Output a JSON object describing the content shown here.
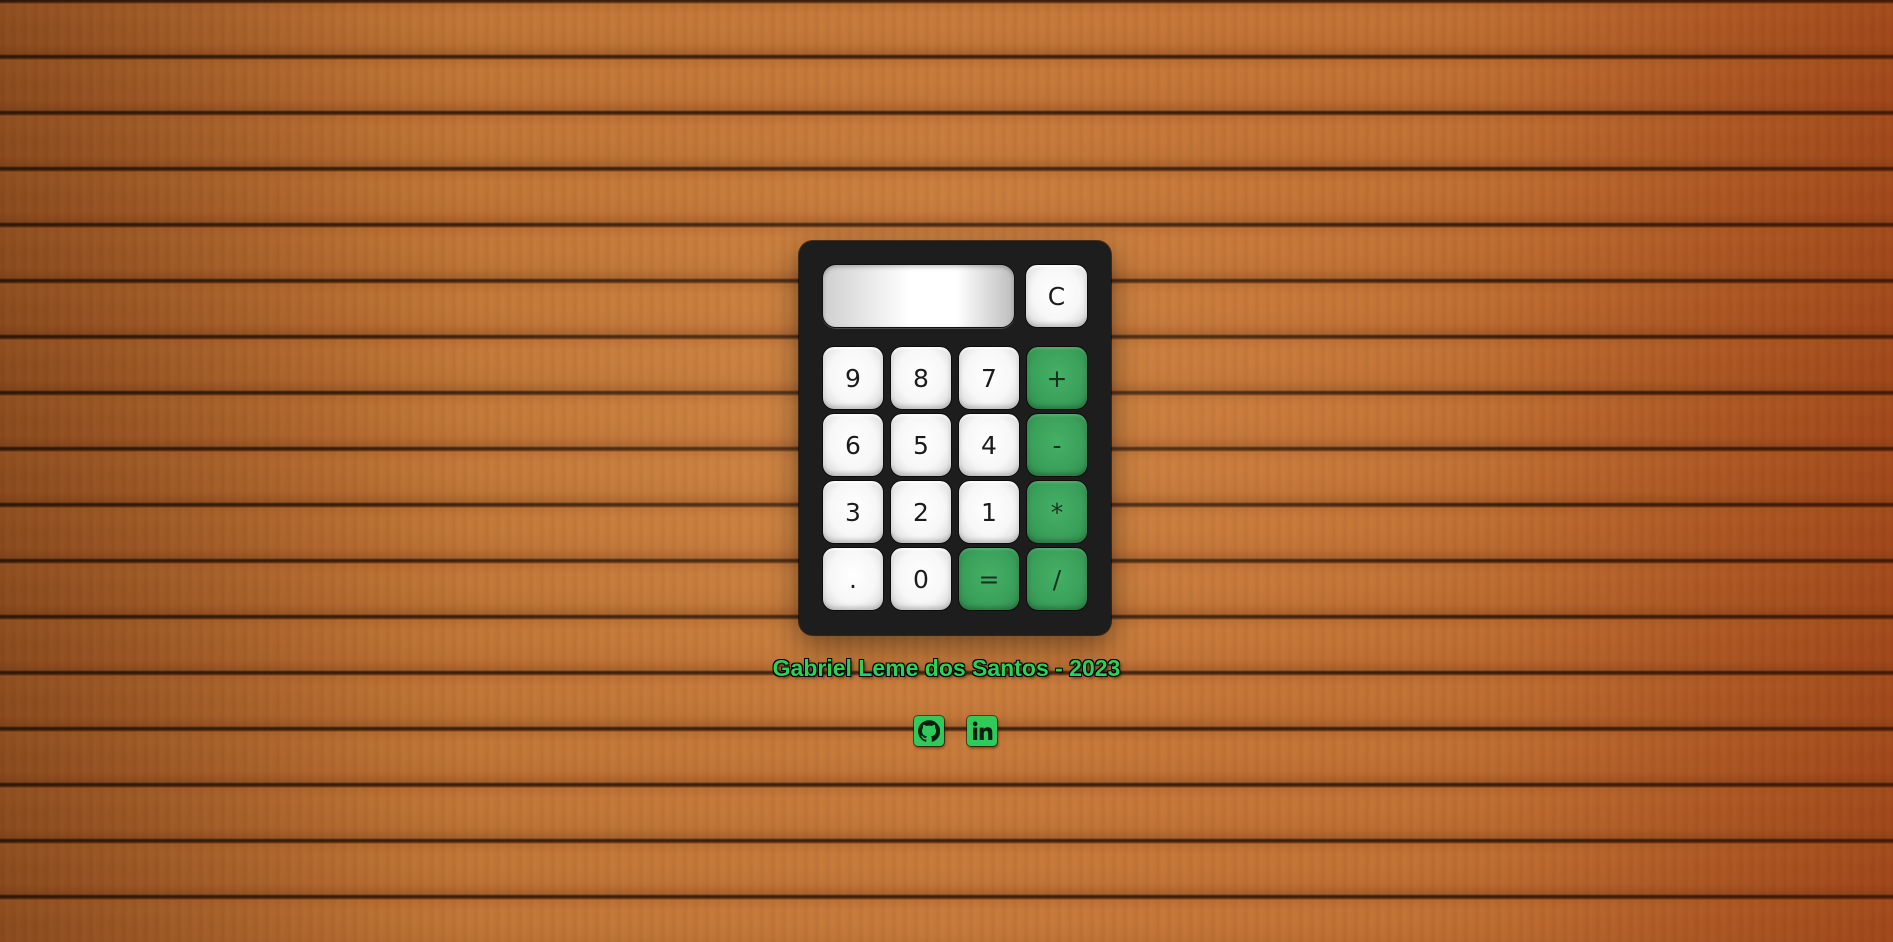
{
  "calculator": {
    "display_value": "",
    "clear_label": "C",
    "keys": {
      "nine": "9",
      "eight": "8",
      "seven": "7",
      "plus": "+",
      "six": "6",
      "five": "5",
      "four": "4",
      "minus": "-",
      "three": "3",
      "two": "2",
      "one": "1",
      "multiply": "*",
      "dot": ".",
      "zero": "0",
      "equals": "=",
      "divide": "/"
    },
    "colors": {
      "body": "#1d1d1d",
      "key_white": "#f7f7f7",
      "key_green": "#3aa05a"
    }
  },
  "footer": {
    "credit": "Gabriel Leme dos Santos - 2023",
    "links": [
      {
        "icon": "github-icon"
      },
      {
        "icon": "linkedin-icon"
      }
    ],
    "accent": "#2ecb5a"
  }
}
